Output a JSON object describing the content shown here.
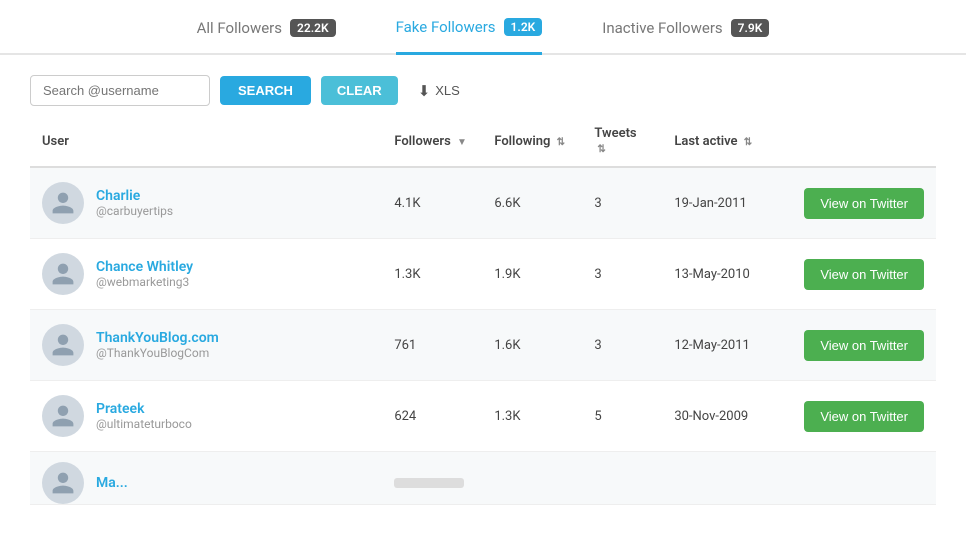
{
  "tabs": [
    {
      "id": "all-followers",
      "label": "All Followers",
      "badge": "22.2K",
      "active": false
    },
    {
      "id": "fake-followers",
      "label": "Fake Followers",
      "badge": "1.2K",
      "active": true
    },
    {
      "id": "inactive-followers",
      "label": "Inactive Followers",
      "badge": "7.9K",
      "active": false
    }
  ],
  "toolbar": {
    "search_placeholder": "Search @username",
    "search_label": "SEARCH",
    "clear_label": "CLEAR",
    "xls_label": "XLS"
  },
  "table": {
    "columns": [
      {
        "id": "user",
        "label": "User",
        "sortable": false
      },
      {
        "id": "followers",
        "label": "Followers",
        "sortable": true
      },
      {
        "id": "following",
        "label": "Following",
        "sortable": true
      },
      {
        "id": "tweets",
        "label": "Tweets",
        "sortable": true
      },
      {
        "id": "last_active",
        "label": "Last active",
        "sortable": true
      },
      {
        "id": "action",
        "label": "",
        "sortable": false
      }
    ],
    "rows": [
      {
        "name": "Charlie",
        "handle": "@carbuyertips",
        "followers": "4.1K",
        "following": "6.6K",
        "tweets": "3",
        "last_active": "19-Jan-2011",
        "action_label": "View on Twitter"
      },
      {
        "name": "Chance Whitley",
        "handle": "@webmarketing3",
        "followers": "1.3K",
        "following": "1.9K",
        "tweets": "3",
        "last_active": "13-May-2010",
        "action_label": "View on Twitter"
      },
      {
        "name": "ThankYouBlog.com",
        "handle": "@ThankYouBlogCom",
        "followers": "761",
        "following": "1.6K",
        "tweets": "3",
        "last_active": "12-May-2011",
        "action_label": "View on Twitter"
      },
      {
        "name": "Prateek",
        "handle": "@ultimateturboco",
        "followers": "624",
        "following": "1.3K",
        "tweets": "5",
        "last_active": "30-Nov-2009",
        "action_label": "View on Twitter"
      }
    ]
  }
}
